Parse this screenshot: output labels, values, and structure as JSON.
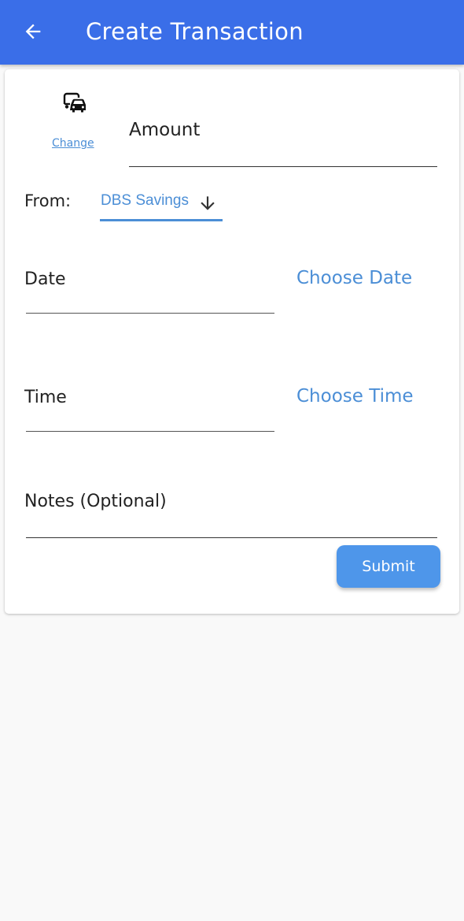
{
  "appbar": {
    "title": "Create Transaction",
    "back_icon": "arrow-left-icon",
    "background": "#3a6ee8"
  },
  "category": {
    "icon": "cars-icon",
    "change_label": "Change"
  },
  "amount": {
    "label": "Amount",
    "value": ""
  },
  "from": {
    "label": "From:",
    "selected": "DBS Savings",
    "dropdown_icon": "arrow-down-icon"
  },
  "date": {
    "label": "Date",
    "action": "Choose Date"
  },
  "time": {
    "label": "Time",
    "action": "Choose Time"
  },
  "notes": {
    "label": "Notes (Optional)",
    "value": ""
  },
  "submit_label": "Submit",
  "colors": {
    "accent": "#4b8ed6",
    "button": "#4e96ea",
    "page_background": "#f9f9f9"
  }
}
